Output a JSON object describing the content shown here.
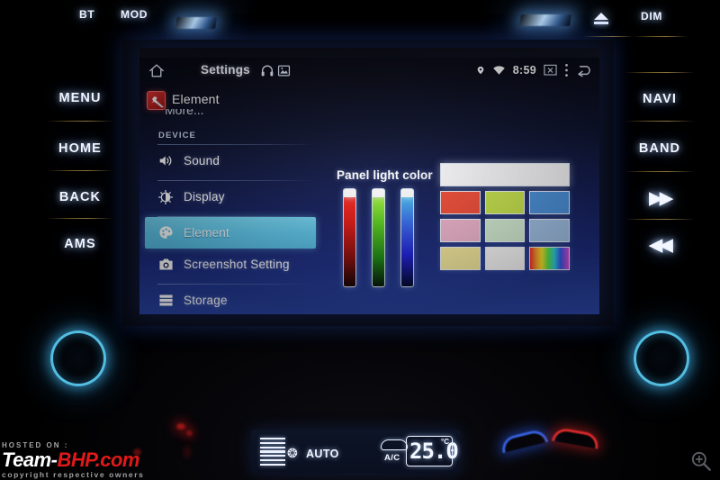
{
  "head_unit": {
    "status_bar": {
      "time": "8:59",
      "icons": [
        "location-pin-icon",
        "wifi-icon",
        "screenshot-icon",
        "overflow-menu-icon",
        "back-arrow-icon"
      ]
    },
    "header": {
      "home_icon": "home-icon",
      "title": "Settings",
      "headphone_icon": "headphone-icon",
      "gallery_icon": "gallery-icon"
    },
    "app_row": {
      "icon": "wrench-tools-icon",
      "label": "Element"
    },
    "more_label": "More...",
    "sidebar": {
      "section_header": "DEVICE",
      "items": [
        {
          "label": "Sound",
          "icon": "speaker-icon",
          "active": false
        },
        {
          "label": "Display",
          "icon": "brightness-icon",
          "active": false
        },
        {
          "label": "Element",
          "icon": "palette-icon",
          "active": true
        },
        {
          "label": "Screenshot Setting",
          "icon": "camera-icon",
          "active": false
        },
        {
          "label": "Storage",
          "icon": "storage-icon",
          "active": false
        }
      ]
    },
    "panel": {
      "title": "Panel light color",
      "sliders": [
        {
          "channel": "red",
          "color": "#ff2d26",
          "value_pct": 100
        },
        {
          "channel": "green",
          "color": "#b6f64a",
          "value_pct": 100
        },
        {
          "channel": "blue",
          "color": "#4fd4f0",
          "value_pct": 100
        }
      ],
      "preview_color": "#fdfdff",
      "swatch_rows": [
        [
          {
            "color": "#f4503a",
            "name": "red-orange"
          },
          {
            "color": "#cbe84f",
            "name": "yellow-green"
          },
          {
            "color": "#4e95e0",
            "name": "blue"
          }
        ],
        [
          {
            "color": "#f3b8d0",
            "name": "pink"
          },
          {
            "color": "#d8f2d8",
            "name": "pale-green"
          },
          {
            "color": "#a5c6ec",
            "name": "light-blue"
          }
        ],
        [
          {
            "color": "#f9eda0",
            "name": "yellow"
          },
          {
            "color": "#ffffff",
            "name": "white"
          },
          {
            "color": "rainbow",
            "name": "rainbow"
          }
        ]
      ]
    }
  },
  "hardware": {
    "top": {
      "bt": "BT",
      "mod": "MOD",
      "eject": "eject-icon",
      "dim": "DIM"
    },
    "left_buttons": [
      "MENU",
      "HOME",
      "BACK",
      "AMS"
    ],
    "right_buttons": [
      {
        "label": "NAVI",
        "type": "text"
      },
      {
        "label": "BAND",
        "type": "text"
      },
      {
        "label": "▶▶",
        "type": "glyph",
        "name": "next-track"
      },
      {
        "label": "◀◀",
        "type": "glyph",
        "name": "previous-track"
      }
    ],
    "knob_left": "volume-knob",
    "knob_right": "tune-knob"
  },
  "climate": {
    "fan_label": "AUTO",
    "fan_icon": "fan-icon",
    "ac_label": "A/C",
    "car_icon": "car-recirculation-icon",
    "temperature": "25.0",
    "unit": "°C"
  },
  "watermark": {
    "hosted": "HOSTED ON :",
    "brand_white": "Team-",
    "brand_red": "BHP.com",
    "copyright": "copyright respective owners"
  },
  "viewer": {
    "zoom_icon": "zoom-in-icon"
  }
}
